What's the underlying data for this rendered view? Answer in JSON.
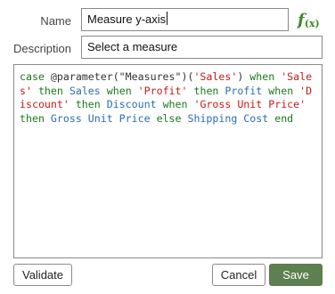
{
  "form": {
    "name_label": "Name",
    "name_value": "Measure y-axis",
    "description_label": "Description",
    "description_placeholder": "Select a measure"
  },
  "icons": {
    "function": "function-icon",
    "fx_main": "f",
    "fx_sub": "(x)"
  },
  "expression": {
    "tokens": [
      {
        "text": "case ",
        "type": "kw"
      },
      {
        "text": "@parameter(\"Measures\")(",
        "type": "plain"
      },
      {
        "text": "'Sales'",
        "type": "str"
      },
      {
        "text": ") ",
        "type": "plain"
      },
      {
        "text": "when ",
        "type": "kw"
      },
      {
        "text": "'Sales'",
        "type": "str"
      },
      {
        "text": " ",
        "type": "plain"
      },
      {
        "text": "then ",
        "type": "kw"
      },
      {
        "text": "Sales ",
        "type": "col"
      },
      {
        "text": "when ",
        "type": "kw"
      },
      {
        "text": "'Profit'",
        "type": "str"
      },
      {
        "text": " ",
        "type": "plain"
      },
      {
        "text": "then ",
        "type": "kw"
      },
      {
        "text": "Profit ",
        "type": "col"
      },
      {
        "text": "when ",
        "type": "kw"
      },
      {
        "text": "'Discount'",
        "type": "str"
      },
      {
        "text": " ",
        "type": "plain"
      },
      {
        "text": "then ",
        "type": "kw"
      },
      {
        "text": "Discount ",
        "type": "col"
      },
      {
        "text": "when ",
        "type": "kw"
      },
      {
        "text": "'Gross Unit Price'",
        "type": "str"
      },
      {
        "text": " ",
        "type": "plain"
      },
      {
        "text": "then ",
        "type": "kw"
      },
      {
        "text": "Gross Unit Price ",
        "type": "col"
      },
      {
        "text": "else ",
        "type": "kw"
      },
      {
        "text": "Shipping Cost ",
        "type": "col"
      },
      {
        "text": "end",
        "type": "kw"
      }
    ]
  },
  "buttons": {
    "validate": "Validate",
    "cancel": "Cancel",
    "save": "Save"
  },
  "colors": {
    "keyword": "#1a7a1a",
    "string": "#c41a1a",
    "column": "#2b6cb0",
    "primary_button": "#5e7f4f",
    "fx_icon": "#3d8a2a"
  }
}
